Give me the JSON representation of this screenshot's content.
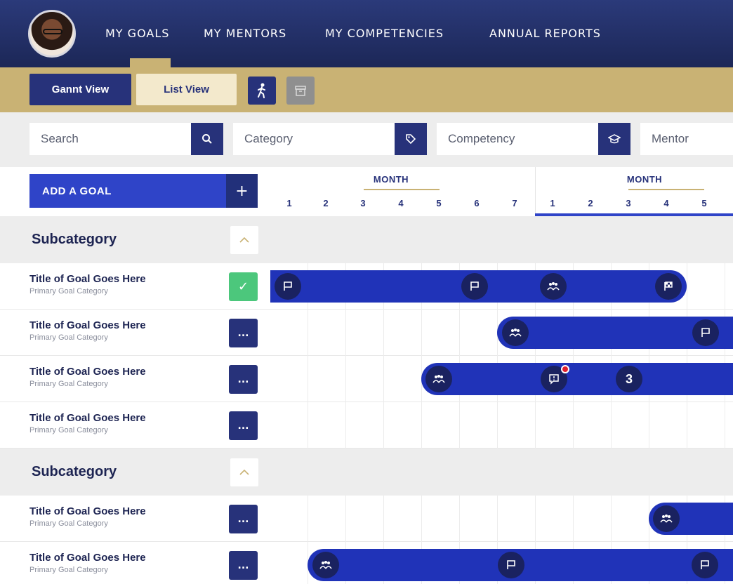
{
  "nav": {
    "items": [
      {
        "label": "MY GOALS"
      },
      {
        "label": "MY MENTORS"
      },
      {
        "label": "MY COMPETENCIES"
      },
      {
        "label": "ANNUAL REPORTS"
      }
    ],
    "active": "MY GOALS"
  },
  "toolbar": {
    "gannt_view": "Gannt View",
    "list_view": "List View",
    "icons": [
      "walking-person-icon",
      "archive-icon"
    ]
  },
  "filters": {
    "search": {
      "placeholder": "Search",
      "icon": "search-icon"
    },
    "category": {
      "placeholder": "Category",
      "icon": "tag-icon"
    },
    "competency": {
      "placeholder": "Competency",
      "icon": "graduation-cap-icon"
    },
    "mentor": {
      "placeholder": "Mentor"
    }
  },
  "add_goal": {
    "label": "ADD A GOAL",
    "plus": "+"
  },
  "timeline": {
    "months": [
      {
        "label": "MONTH",
        "days": [
          "1",
          "2",
          "3",
          "4",
          "5",
          "6",
          "7"
        ]
      },
      {
        "label": "MONTH",
        "days": [
          "1",
          "2",
          "3",
          "4",
          "5"
        ]
      }
    ]
  },
  "groups": [
    {
      "subcategory": "Subcategory",
      "goals": [
        {
          "title": "Title of Goal Goes Here",
          "category": "Primary Goal Category",
          "status": "done",
          "action": "✓"
        },
        {
          "title": "Title of Goal Goes Here",
          "category": "Primary Goal Category",
          "status": "more",
          "action": "..."
        },
        {
          "title": "Title of Goal Goes Here",
          "category": "Primary Goal Category",
          "status": "more",
          "action": "...",
          "badge": "3"
        },
        {
          "title": "Title of Goal Goes Here",
          "category": "Primary Goal Category",
          "status": "more",
          "action": "..."
        }
      ]
    },
    {
      "subcategory": "Subcategory",
      "goals": [
        {
          "title": "Title of Goal Goes Here",
          "category": "Primary Goal Category",
          "status": "more",
          "action": "..."
        },
        {
          "title": "Title of Goal Goes Here",
          "category": "Primary Goal Category",
          "status": "more",
          "action": "..."
        }
      ]
    }
  ],
  "colors": {
    "navy": "#27327a",
    "gold": "#c9b274",
    "bar_blue": "#2033b8",
    "success_green": "#4cc77c",
    "alert_red": "#e0202e"
  }
}
